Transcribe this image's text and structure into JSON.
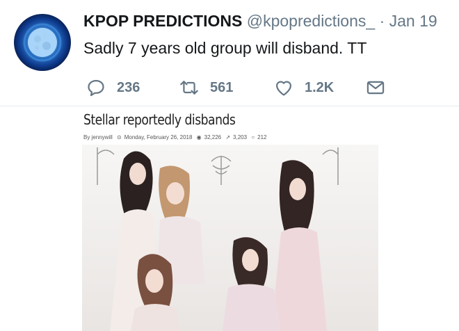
{
  "tweet": {
    "display_name": "KPOP PREDICTIONS",
    "handle": "@kpopredictions_",
    "separator": "·",
    "date": "Jan 19",
    "text": "Sadly 7 years old group will disband. TT",
    "actions": {
      "reply": {
        "icon": "reply-icon",
        "count": "236"
      },
      "retweet": {
        "icon": "retweet-icon",
        "count": "561"
      },
      "like": {
        "icon": "heart-icon",
        "count": "1.2K"
      },
      "message": {
        "icon": "envelope-icon"
      }
    }
  },
  "article": {
    "headline": "Stellar reportedly disbands",
    "byline": "By jennywill",
    "date": "Monday, February 26, 2018",
    "views": "32,226",
    "shares": "3,203",
    "comments": "212"
  },
  "colors": {
    "text": "#14171a",
    "muted": "#657786",
    "divider": "#e6ecf0"
  }
}
